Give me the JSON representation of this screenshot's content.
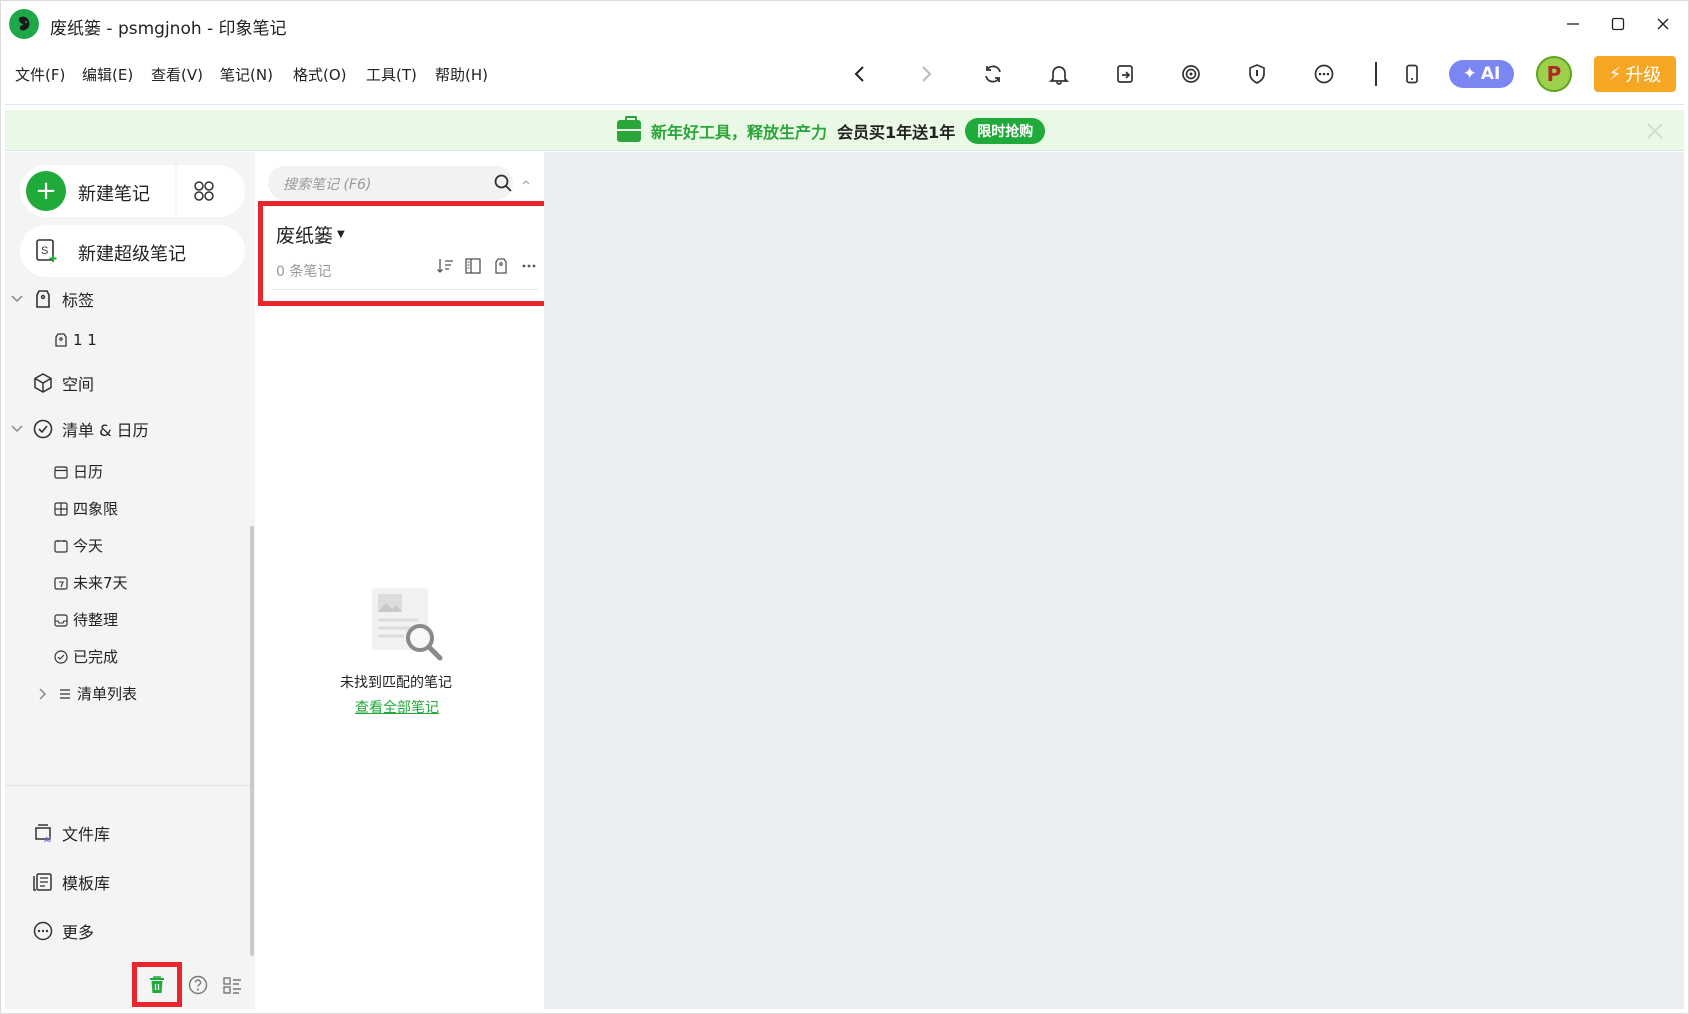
{
  "window": {
    "title": "废纸篓 - psmgjnoh - 印象笔记",
    "controls": [
      "minimize-icon",
      "maximize-icon",
      "close-icon"
    ]
  },
  "menu": {
    "items": [
      "文件(F)",
      "编辑(E)",
      "查看(V)",
      "笔记(N)",
      "格式(O)",
      "工具(T)",
      "帮助(H)"
    ]
  },
  "toolbar": {
    "icons": [
      "back-arrow-icon",
      "forward-arrow-icon",
      "sync-icon",
      "bell-icon",
      "share-icon",
      "target-icon",
      "shield-icon",
      "more-icon",
      "phone-icon"
    ],
    "ai_label": "AI",
    "avatar_letter": "P",
    "upgrade_label": "升级"
  },
  "banner": {
    "green_text": "新年好工具，释放生产力",
    "dark_text": "会员买1年送1年",
    "button_label": "限时抢购"
  },
  "sidebar": {
    "new_note_label": "新建笔记",
    "new_super_note_label": "新建超级笔记",
    "tags_label": "标签",
    "tag_item": "1  1",
    "space_label": "空间",
    "checklist_calendar_label": "清单 & 日历",
    "sub_items": [
      "日历",
      "四象限",
      "今天",
      "未来7天",
      "待整理",
      "已完成",
      "清单列表"
    ],
    "library_label": "文件库",
    "template_label": "模板库",
    "more_label": "更多"
  },
  "notelist": {
    "search_placeholder": "搜索笔记 (F6)",
    "notebook_name": "废纸篓",
    "note_count": "0 条笔记",
    "empty_text": "未找到匹配的笔记",
    "empty_link": "查看全部笔记"
  },
  "colors": {
    "brand_green": "#1faa3a",
    "highlight_red": "#e8262c",
    "ai_purple": "#7b86f2",
    "upgrade_orange": "#f5a623",
    "banner_bg": "#eaf8e6"
  }
}
